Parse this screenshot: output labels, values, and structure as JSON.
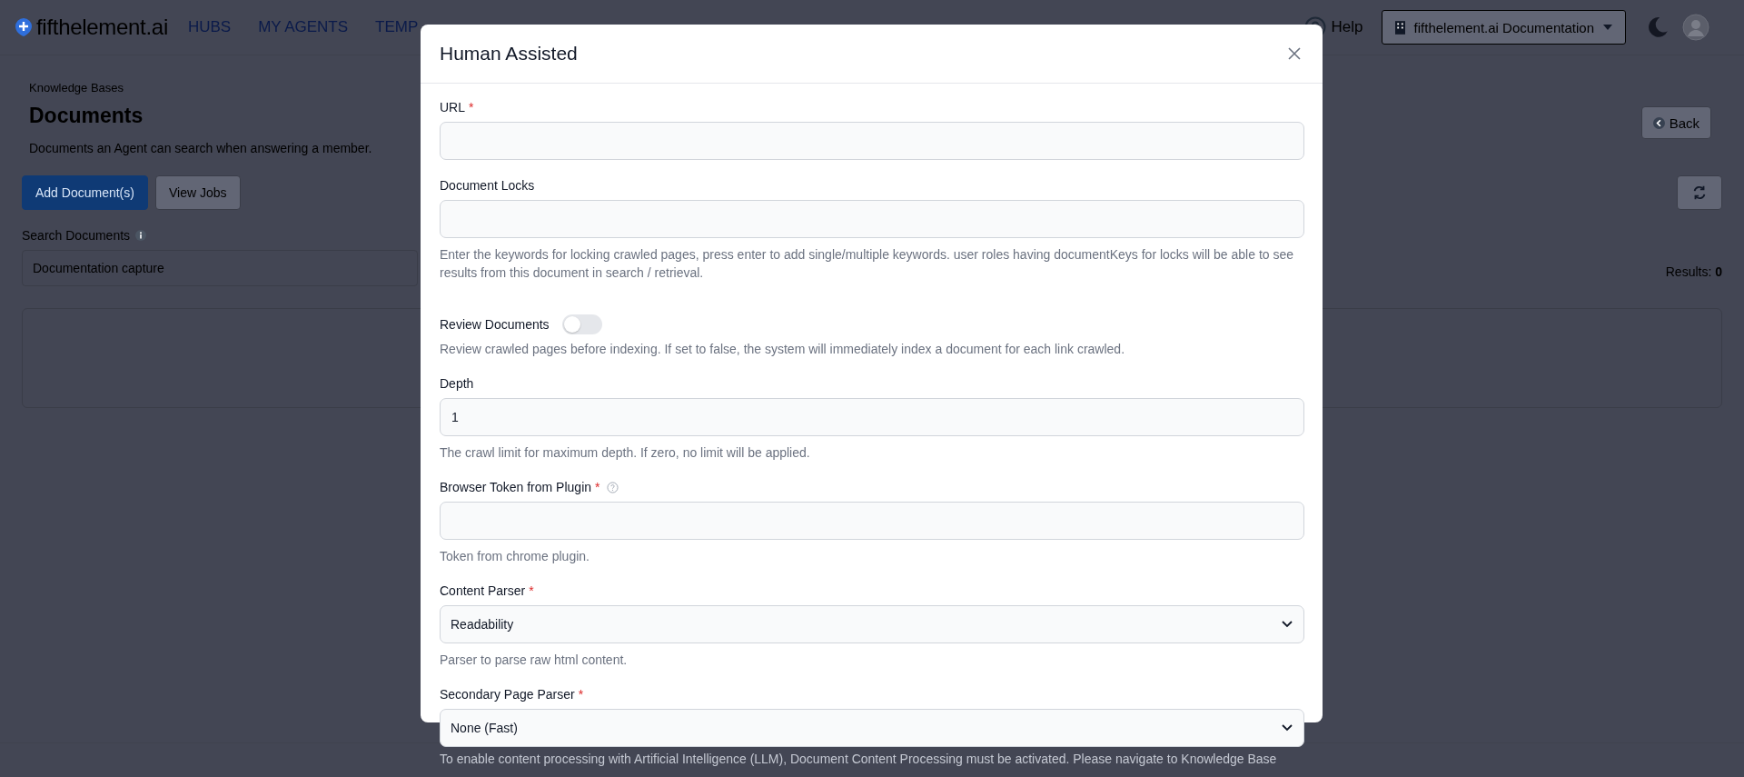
{
  "nav": {
    "brand": "fifthelement.ai",
    "items": [
      "HUBS",
      "MY AGENTS",
      "TEMP"
    ],
    "help": "Help",
    "workspace": "fifthelement.ai Documentation"
  },
  "page": {
    "breadcrumb": "Knowledge Bases",
    "title": "Documents",
    "subtitle": "Documents an Agent can search when answering a member.",
    "back": "Back",
    "buttons": [
      {
        "label": "Add Document(s)",
        "primary": true
      },
      {
        "label": "View Jobs",
        "primary": false
      }
    ],
    "search_label": "Search Documents",
    "search_value": "Documentation capture",
    "results_label": "Results:",
    "results_count": "0"
  },
  "modal": {
    "title": "Human Assisted",
    "required_marker": "*",
    "fields": [
      {
        "kind": "text",
        "label": "URL",
        "required": true
      },
      {
        "kind": "text",
        "label": "Document Locks",
        "required": false,
        "help": "Enter the keywords for locking crawled pages, press enter to add single/multiple keywords. user roles having documentKeys for locks will be able to see results from this document in search / retrieval."
      },
      {
        "kind": "toggle",
        "label": "Review Documents",
        "required": false,
        "on": false,
        "help": "Review crawled pages before indexing. If set to false, the system will immediately index a document for each link crawled."
      },
      {
        "kind": "text",
        "label": "Depth",
        "required": false,
        "value": "1",
        "help": "The crawl limit for maximum depth. If zero, no limit will be applied."
      },
      {
        "kind": "text",
        "label": "Browser Token from Plugin",
        "required": true,
        "info": true,
        "help": "Token from chrome plugin."
      },
      {
        "kind": "select",
        "label": "Content Parser",
        "required": true,
        "value": "Readability",
        "help": "Parser to parse raw html content."
      },
      {
        "kind": "select",
        "label": "Secondary Page Parser",
        "required": true,
        "value": "None (Fast)"
      }
    ],
    "note": "To enable content processing with Artificial Intelligence (LLM), Document Content Processing must be activated. Please navigate to Knowledge Base"
  }
}
